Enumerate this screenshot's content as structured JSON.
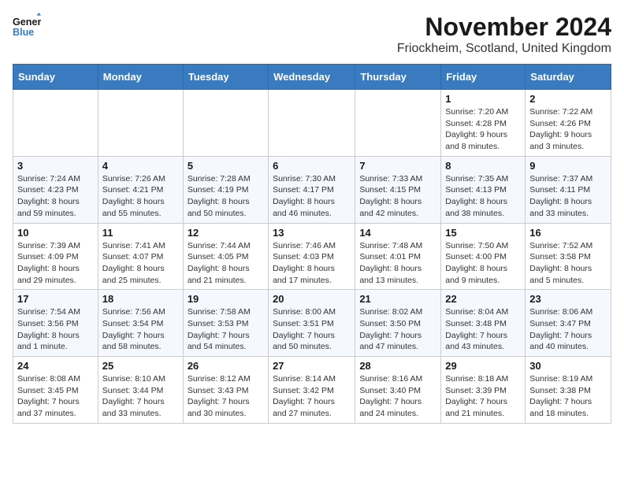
{
  "logo": {
    "line1": "General",
    "line2": "Blue"
  },
  "title": "November 2024",
  "location": "Friockheim, Scotland, United Kingdom",
  "days_of_week": [
    "Sunday",
    "Monday",
    "Tuesday",
    "Wednesday",
    "Thursday",
    "Friday",
    "Saturday"
  ],
  "weeks": [
    [
      {
        "day": "",
        "info": ""
      },
      {
        "day": "",
        "info": ""
      },
      {
        "day": "",
        "info": ""
      },
      {
        "day": "",
        "info": ""
      },
      {
        "day": "",
        "info": ""
      },
      {
        "day": "1",
        "info": "Sunrise: 7:20 AM\nSunset: 4:28 PM\nDaylight: 9 hours\nand 8 minutes."
      },
      {
        "day": "2",
        "info": "Sunrise: 7:22 AM\nSunset: 4:26 PM\nDaylight: 9 hours\nand 3 minutes."
      }
    ],
    [
      {
        "day": "3",
        "info": "Sunrise: 7:24 AM\nSunset: 4:23 PM\nDaylight: 8 hours\nand 59 minutes."
      },
      {
        "day": "4",
        "info": "Sunrise: 7:26 AM\nSunset: 4:21 PM\nDaylight: 8 hours\nand 55 minutes."
      },
      {
        "day": "5",
        "info": "Sunrise: 7:28 AM\nSunset: 4:19 PM\nDaylight: 8 hours\nand 50 minutes."
      },
      {
        "day": "6",
        "info": "Sunrise: 7:30 AM\nSunset: 4:17 PM\nDaylight: 8 hours\nand 46 minutes."
      },
      {
        "day": "7",
        "info": "Sunrise: 7:33 AM\nSunset: 4:15 PM\nDaylight: 8 hours\nand 42 minutes."
      },
      {
        "day": "8",
        "info": "Sunrise: 7:35 AM\nSunset: 4:13 PM\nDaylight: 8 hours\nand 38 minutes."
      },
      {
        "day": "9",
        "info": "Sunrise: 7:37 AM\nSunset: 4:11 PM\nDaylight: 8 hours\nand 33 minutes."
      }
    ],
    [
      {
        "day": "10",
        "info": "Sunrise: 7:39 AM\nSunset: 4:09 PM\nDaylight: 8 hours\nand 29 minutes."
      },
      {
        "day": "11",
        "info": "Sunrise: 7:41 AM\nSunset: 4:07 PM\nDaylight: 8 hours\nand 25 minutes."
      },
      {
        "day": "12",
        "info": "Sunrise: 7:44 AM\nSunset: 4:05 PM\nDaylight: 8 hours\nand 21 minutes."
      },
      {
        "day": "13",
        "info": "Sunrise: 7:46 AM\nSunset: 4:03 PM\nDaylight: 8 hours\nand 17 minutes."
      },
      {
        "day": "14",
        "info": "Sunrise: 7:48 AM\nSunset: 4:01 PM\nDaylight: 8 hours\nand 13 minutes."
      },
      {
        "day": "15",
        "info": "Sunrise: 7:50 AM\nSunset: 4:00 PM\nDaylight: 8 hours\nand 9 minutes."
      },
      {
        "day": "16",
        "info": "Sunrise: 7:52 AM\nSunset: 3:58 PM\nDaylight: 8 hours\nand 5 minutes."
      }
    ],
    [
      {
        "day": "17",
        "info": "Sunrise: 7:54 AM\nSunset: 3:56 PM\nDaylight: 8 hours\nand 1 minute."
      },
      {
        "day": "18",
        "info": "Sunrise: 7:56 AM\nSunset: 3:54 PM\nDaylight: 7 hours\nand 58 minutes."
      },
      {
        "day": "19",
        "info": "Sunrise: 7:58 AM\nSunset: 3:53 PM\nDaylight: 7 hours\nand 54 minutes."
      },
      {
        "day": "20",
        "info": "Sunrise: 8:00 AM\nSunset: 3:51 PM\nDaylight: 7 hours\nand 50 minutes."
      },
      {
        "day": "21",
        "info": "Sunrise: 8:02 AM\nSunset: 3:50 PM\nDaylight: 7 hours\nand 47 minutes."
      },
      {
        "day": "22",
        "info": "Sunrise: 8:04 AM\nSunset: 3:48 PM\nDaylight: 7 hours\nand 43 minutes."
      },
      {
        "day": "23",
        "info": "Sunrise: 8:06 AM\nSunset: 3:47 PM\nDaylight: 7 hours\nand 40 minutes."
      }
    ],
    [
      {
        "day": "24",
        "info": "Sunrise: 8:08 AM\nSunset: 3:45 PM\nDaylight: 7 hours\nand 37 minutes."
      },
      {
        "day": "25",
        "info": "Sunrise: 8:10 AM\nSunset: 3:44 PM\nDaylight: 7 hours\nand 33 minutes."
      },
      {
        "day": "26",
        "info": "Sunrise: 8:12 AM\nSunset: 3:43 PM\nDaylight: 7 hours\nand 30 minutes."
      },
      {
        "day": "27",
        "info": "Sunrise: 8:14 AM\nSunset: 3:42 PM\nDaylight: 7 hours\nand 27 minutes."
      },
      {
        "day": "28",
        "info": "Sunrise: 8:16 AM\nSunset: 3:40 PM\nDaylight: 7 hours\nand 24 minutes."
      },
      {
        "day": "29",
        "info": "Sunrise: 8:18 AM\nSunset: 3:39 PM\nDaylight: 7 hours\nand 21 minutes."
      },
      {
        "day": "30",
        "info": "Sunrise: 8:19 AM\nSunset: 3:38 PM\nDaylight: 7 hours\nand 18 minutes."
      }
    ]
  ]
}
